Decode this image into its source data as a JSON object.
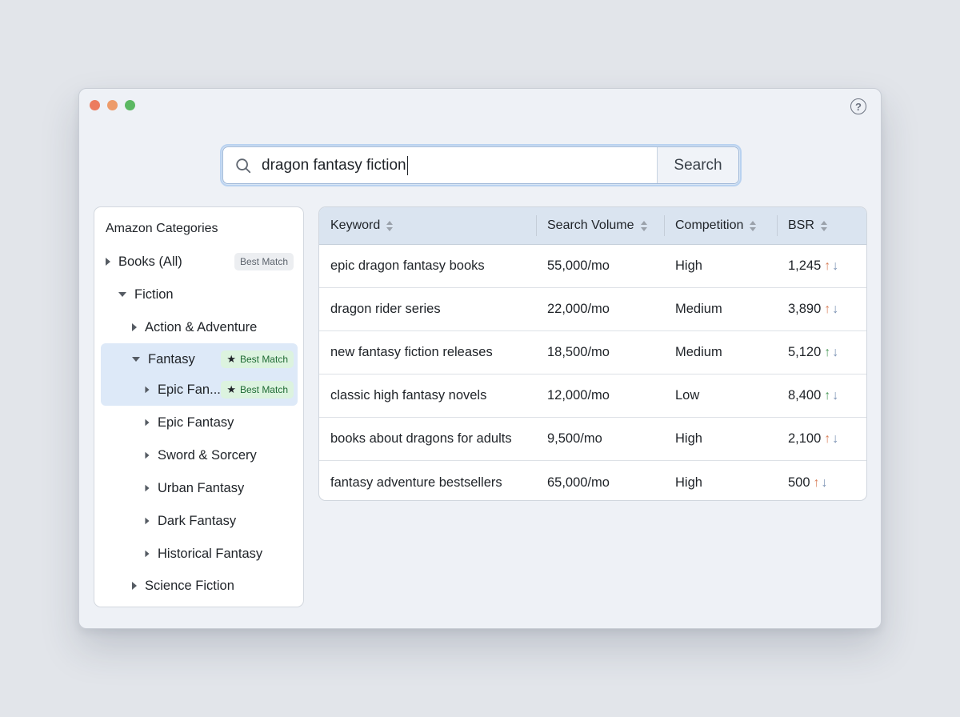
{
  "window": {
    "help_glyph": "?"
  },
  "search": {
    "value": "dragon fantasy fiction",
    "button_label": "Search"
  },
  "sidebar": {
    "title": "Amazon Categories",
    "items": [
      {
        "label": "Books (All)",
        "expanded": false,
        "badge": "Best Match",
        "badge_style": "gray"
      },
      {
        "label": "Fiction",
        "expanded": true
      },
      {
        "label": "Action & Adventure",
        "expanded": false
      },
      {
        "label": "Fantasy",
        "expanded": true,
        "badge": "Best Match",
        "badge_style": "green",
        "selected": true
      },
      {
        "label": "Epic Fan...",
        "expanded": false,
        "badge": "Best Match",
        "badge_style": "green",
        "selected": true
      },
      {
        "label": "Epic Fantasy",
        "expanded": false
      },
      {
        "label": "Sword & Sorcery",
        "expanded": false
      },
      {
        "label": "Urban Fantasy",
        "expanded": false
      },
      {
        "label": "Dark Fantasy",
        "expanded": false
      },
      {
        "label": "Historical Fantasy",
        "expanded": false
      },
      {
        "label": "Science Fiction",
        "expanded": false
      }
    ]
  },
  "table": {
    "columns": [
      "Keyword",
      "Search Volume",
      "Competition",
      "BSR"
    ],
    "rows": [
      {
        "keyword": "epic dragon fantasy books",
        "volume": "55,000/mo",
        "competition": "High",
        "bsr": "1,245",
        "trend_color": "#d9805b"
      },
      {
        "keyword": "dragon rider series",
        "volume": "22,000/mo",
        "competition": "Medium",
        "bsr": "3,890",
        "trend_color": "#d9805b"
      },
      {
        "keyword": "new fantasy fiction releases",
        "volume": "18,500/mo",
        "competition": "Medium",
        "bsr": "5,120",
        "trend_color": "#4f9c5d"
      },
      {
        "keyword": "classic high fantasy novels",
        "volume": "12,000/mo",
        "competition": "Low",
        "bsr": "8,400",
        "trend_color": "#4f9c5d"
      },
      {
        "keyword": "books about dragons for adults",
        "volume": "9,500/mo",
        "competition": "High",
        "bsr": "2,100",
        "trend_color": "#d9805b"
      },
      {
        "keyword": "fantasy adventure bestsellers",
        "volume": "65,000/mo",
        "competition": "High",
        "bsr": "500",
        "trend_color": "#d9805b"
      }
    ]
  },
  "colors": {
    "accent": "#b9d2f0",
    "selected_bg": "#dde9f8",
    "badge_green_bg": "#dcf3df",
    "trend_up_orange": "#d9805b",
    "trend_up_green": "#4f9c5d",
    "trend_down": "#7990b3"
  },
  "icons": {
    "trend_up": "↑",
    "trend_down": "↓",
    "star": "★"
  }
}
